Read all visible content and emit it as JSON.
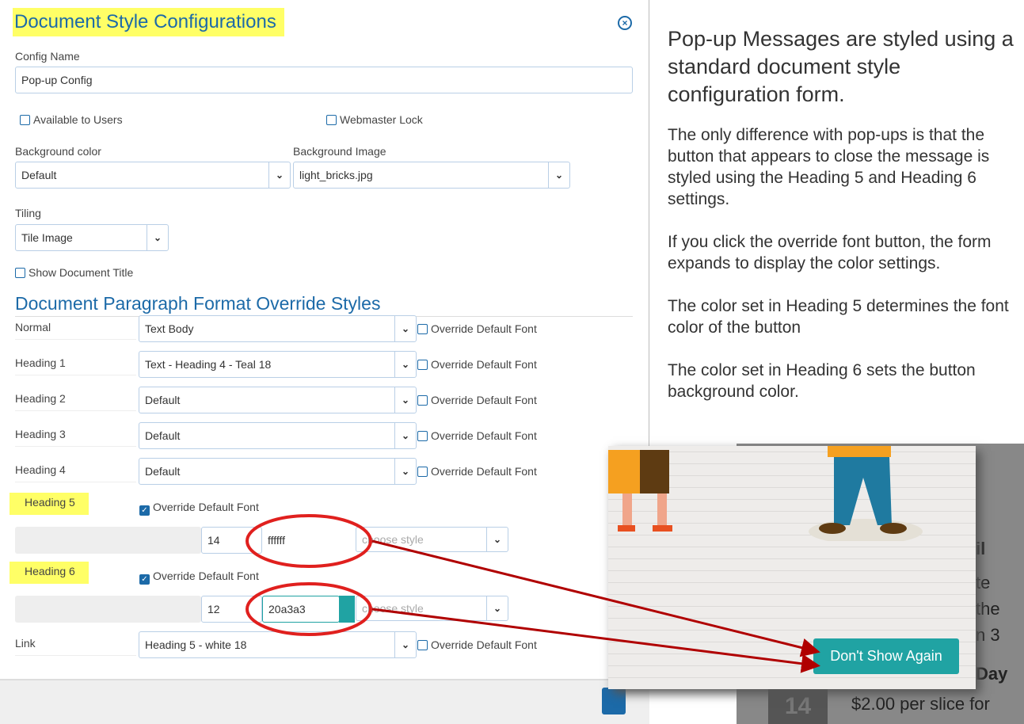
{
  "modal": {
    "title": "Document Style Configurations",
    "config_name_label": "Config Name",
    "config_name_value": "Pop-up Config",
    "available_label": "Available to Users",
    "webmaster_label": "Webmaster Lock",
    "bg_color_label": "Background color",
    "bg_color_value": "Default",
    "bg_image_label": "Background Image",
    "bg_image_value": "light_bricks.jpg",
    "tiling_label": "Tiling",
    "tiling_value": "Tile Image",
    "show_title_label": "Show Document Title",
    "section_title": "Document Paragraph Format Override Styles",
    "override_label": "Override Default Font",
    "rows": [
      {
        "label": "Normal",
        "value": "Text Body"
      },
      {
        "label": "Heading 1",
        "value": "Text - Heading 4 - Teal 18"
      },
      {
        "label": "Heading 2",
        "value": "Default"
      },
      {
        "label": "Heading 3",
        "value": "Default"
      },
      {
        "label": "Heading 4",
        "value": "Default"
      }
    ],
    "h5": {
      "label": "Heading 5",
      "size": "14",
      "color": "ffffff",
      "style_placeholder": "choose style"
    },
    "h6": {
      "label": "Heading 6",
      "size": "12",
      "color": "20a3a3",
      "style_placeholder": "choose style"
    },
    "link": {
      "label": "Link",
      "value": "Heading 5 - white 18"
    }
  },
  "side": {
    "heading": "Pop-up Messages are styled using a standard document style configuration form.",
    "p1": "The only difference with pop-ups is that the button that appears to close the message is styled using the Heading 5 and Heading 6 settings.",
    "p2": "If you click the override font button, the form expands to display the color settings.",
    "p3": "The color set in Heading 5 determines the font color of the button",
    "p4": "The color set in Heading 6 sets the button background color."
  },
  "popup": {
    "button": "Don't Show Again",
    "button_bg": "#20a3a3",
    "button_fg": "#ffffff"
  },
  "behind": {
    "t1": "il",
    "t2": "te",
    "t3": "the",
    "t4": "n 3",
    "t5": "Day",
    "num": "14",
    "price": "$2.00 per slice for"
  },
  "colors": {
    "accent": "#1c6aa8",
    "highlight": "#ffff66",
    "annotation": "#b00000"
  }
}
